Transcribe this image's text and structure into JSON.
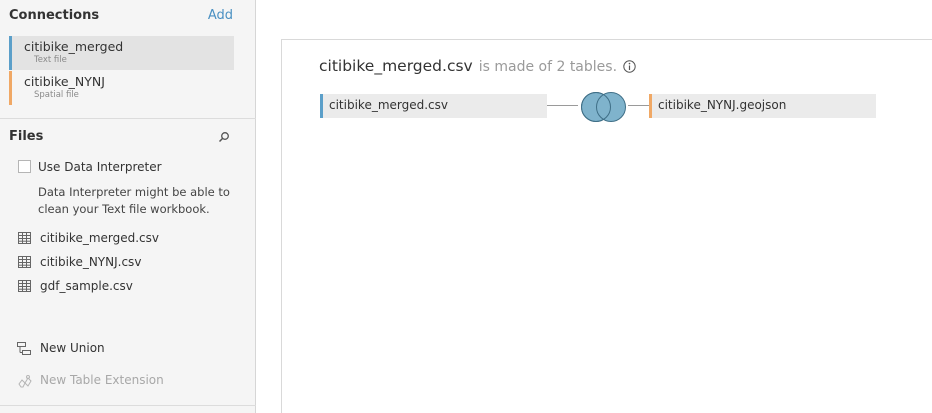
{
  "sidebar": {
    "connections_header": "Connections",
    "add_label": "Add",
    "connections": [
      {
        "name": "citibike_merged",
        "type": "Text file"
      },
      {
        "name": "citibike_NYNJ",
        "type": "Spatial file"
      }
    ],
    "files_header": "Files",
    "use_interpreter_label": "Use Data Interpreter",
    "interpreter_desc": "Data Interpreter might be able to clean your Text file workbook.",
    "files": [
      "citibike_merged.csv",
      "citibike_NYNJ.csv",
      "gdf_sample.csv"
    ],
    "new_union_label": "New Union",
    "new_table_extension_label": "New Table Extension"
  },
  "canvas": {
    "title": "citibike_merged.csv",
    "subtitle": "is made of 2 tables.",
    "left_table": "citibike_merged.csv",
    "right_table": "citibike_NYNJ.geojson"
  },
  "colors": {
    "text_file_accent": "#5b9fc9",
    "spatial_file_accent": "#f0a865",
    "join_fill": "#7fb3cc",
    "link": "#4a90c2"
  },
  "icons": {
    "search": "search-icon",
    "info": "info-icon",
    "table": "table-icon",
    "union": "union-icon",
    "extension": "table-extension-icon",
    "join": "inner-join-icon"
  }
}
